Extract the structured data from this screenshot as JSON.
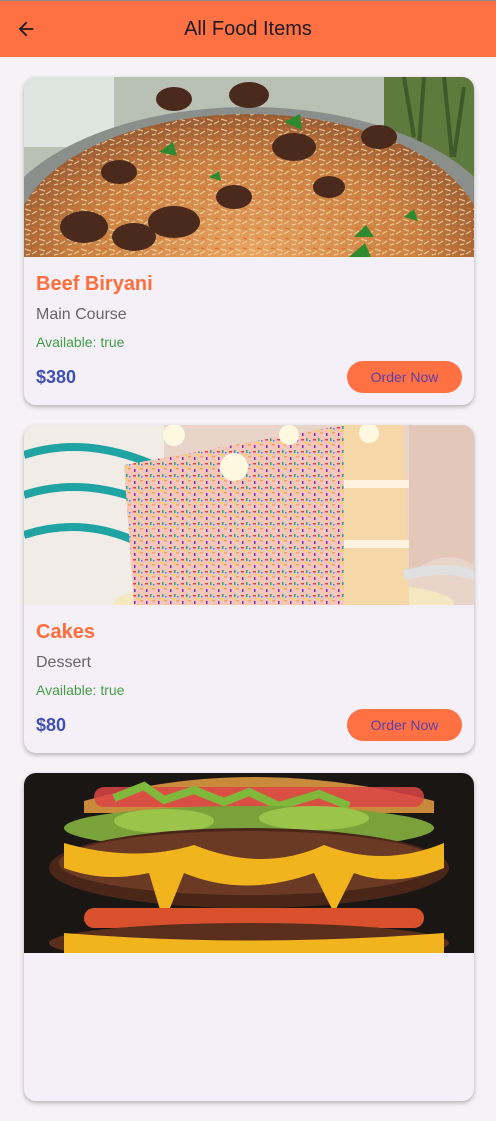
{
  "appbar": {
    "title": "All Food Items",
    "back_icon": "arrow-left-icon",
    "background": "#ff7043"
  },
  "colors": {
    "name": "#ff6e3a",
    "price": "#3f51b5",
    "available": "#43a047",
    "button": "#ff7043",
    "button_text": "#5c3fa8"
  },
  "items": [
    {
      "name": "Beef Biryani",
      "category": "Main Course",
      "available": "Available: true",
      "price": "$380",
      "button": "Order Now"
    },
    {
      "name": "Cakes",
      "category": "Dessert",
      "available": "Available: true",
      "price": "$80",
      "button": "Order Now"
    },
    {
      "name": "",
      "category": "",
      "available": "",
      "price": "",
      "button": ""
    }
  ]
}
